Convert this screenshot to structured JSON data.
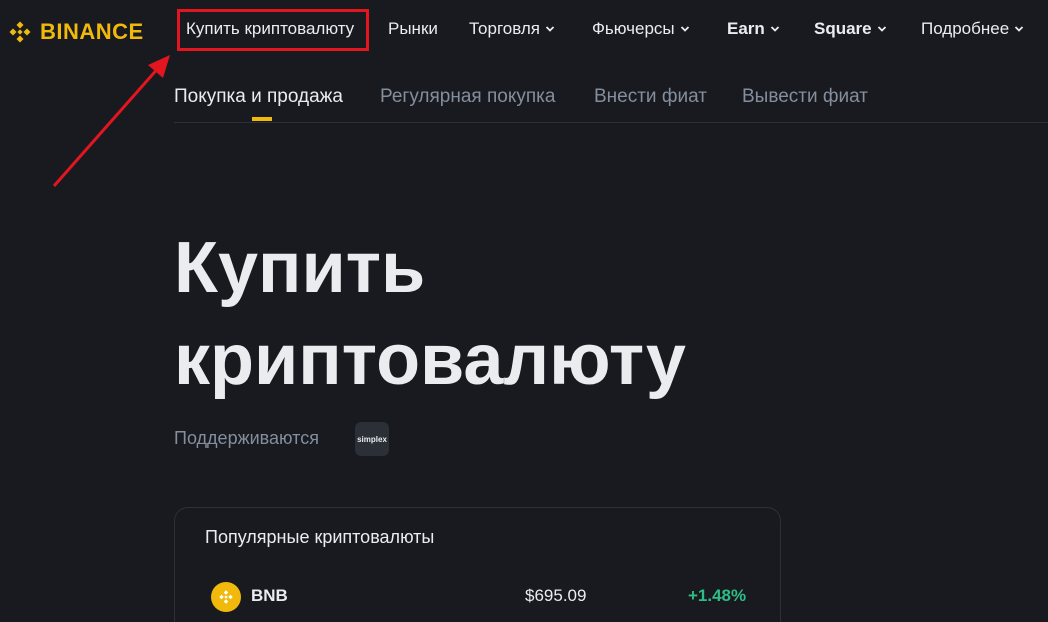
{
  "brand": {
    "name": "BINANCE",
    "color": "#f0b90b"
  },
  "topnav": {
    "items": [
      {
        "label": "Купить криптовалюту",
        "dropdown": false
      },
      {
        "label": "Рынки",
        "dropdown": false
      },
      {
        "label": "Торговля",
        "dropdown": true
      },
      {
        "label": "Фьючерсы",
        "dropdown": true
      },
      {
        "label": "Earn",
        "dropdown": true
      },
      {
        "label": "Square",
        "dropdown": true
      },
      {
        "label": "Подробнее",
        "dropdown": true
      }
    ]
  },
  "annotation": {
    "color": "#e3161f",
    "highlighted_item": "Купить криптовалюту"
  },
  "subnav": {
    "tabs": [
      {
        "label": "Покупка и продажа",
        "active": true
      },
      {
        "label": "Регулярная покупка",
        "active": false
      },
      {
        "label": "Внести фиат",
        "active": false
      },
      {
        "label": "Вывести фиат",
        "active": false
      }
    ]
  },
  "hero": {
    "title_line1": "Купить",
    "title_line2": "криптовалюту",
    "supported_label": "Поддерживаются",
    "provider_logo": "simplex"
  },
  "popular": {
    "title": "Популярные криптовалюты",
    "coins": [
      {
        "symbol": "BNB",
        "price": "$695.09",
        "change": "+1.48%",
        "change_color": "#2ebd85",
        "icon": "bnb-icon"
      }
    ]
  }
}
